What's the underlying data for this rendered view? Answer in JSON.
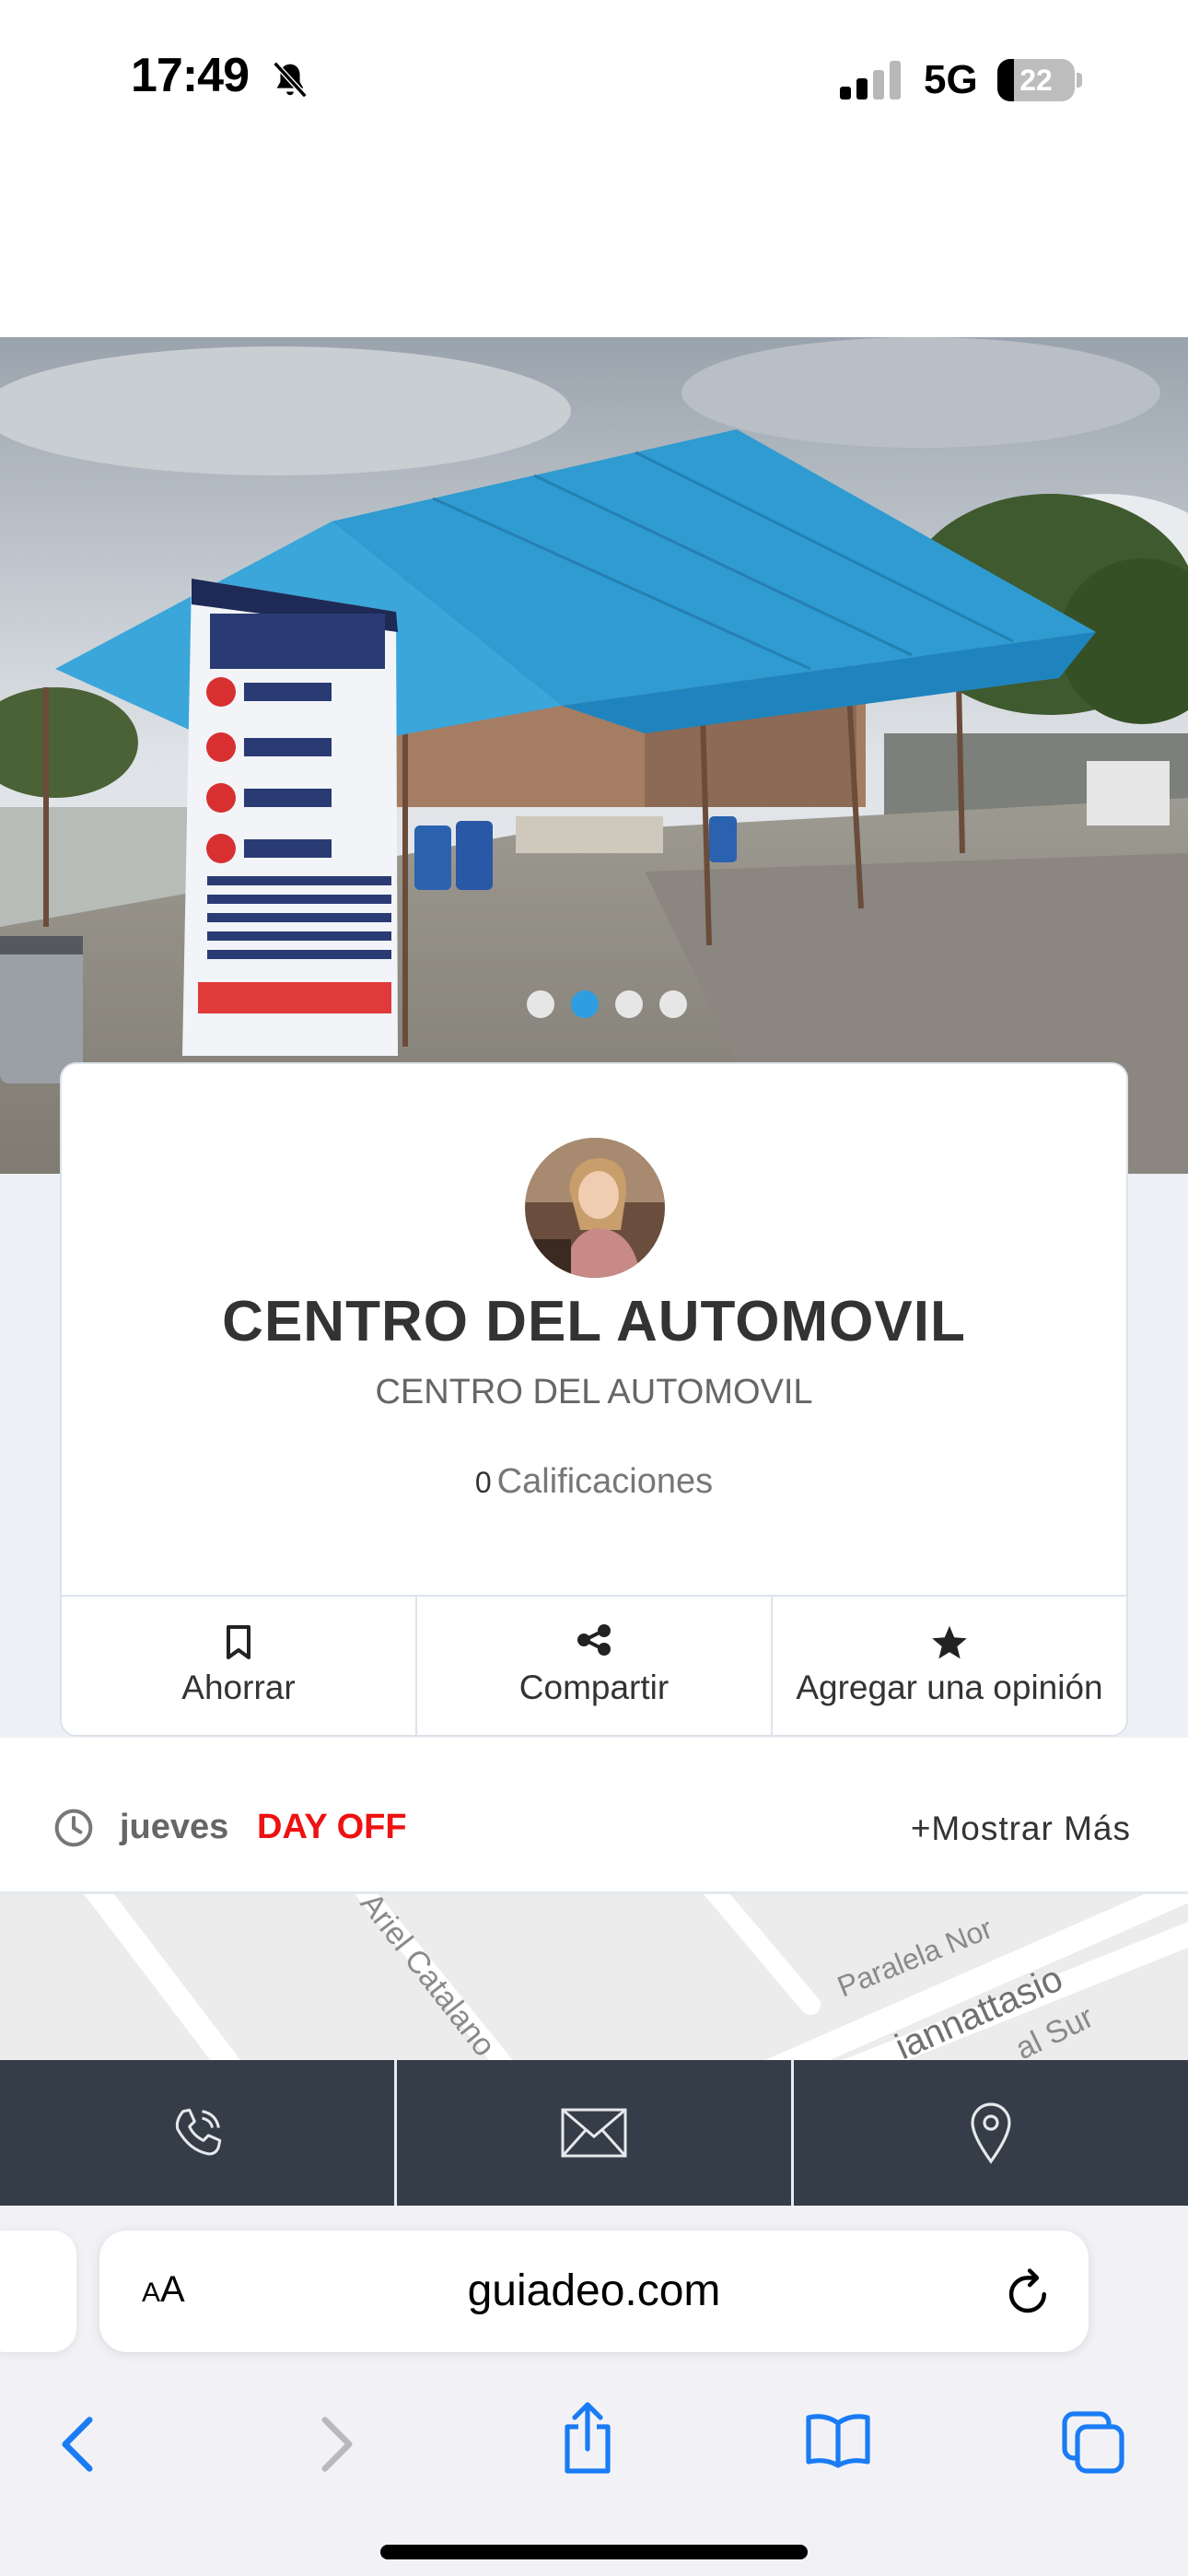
{
  "status_bar": {
    "time": "17:49",
    "network": "5G",
    "battery_level": "22",
    "battery_fraction": 0.22,
    "silent_icon": "bell-slash-icon",
    "signal_icon": "cellular-signal-icon"
  },
  "gallery": {
    "slide_count": 4,
    "active_slide": 2,
    "active_color": "#2e9ee0"
  },
  "business": {
    "name": "CENTRO DEL AUTOMOVIL",
    "subtitle": "CENTRO DEL AUTOMOVIL",
    "rating_count": "0",
    "rating_label": "Calificaciones"
  },
  "actions": {
    "save_label": "Ahorrar",
    "share_label": "Compartir",
    "review_label": "Agregar una opinión"
  },
  "hours": {
    "day": "jueves",
    "status": "DAY OFF",
    "status_color": "#ee1111",
    "show_more": "+Mostrar Más"
  },
  "map": {
    "streets": [
      "Ariel Catalano",
      "Paralela Nor",
      "iannattasio",
      "al Sur"
    ]
  },
  "contact_bar": {
    "background": "#353d48",
    "icons": [
      "phone-icon",
      "mail-icon",
      "location-pin-icon"
    ]
  },
  "safari": {
    "text_size_label": "AA",
    "url": "guiadeo.com",
    "accent": "#1a7cf5"
  }
}
